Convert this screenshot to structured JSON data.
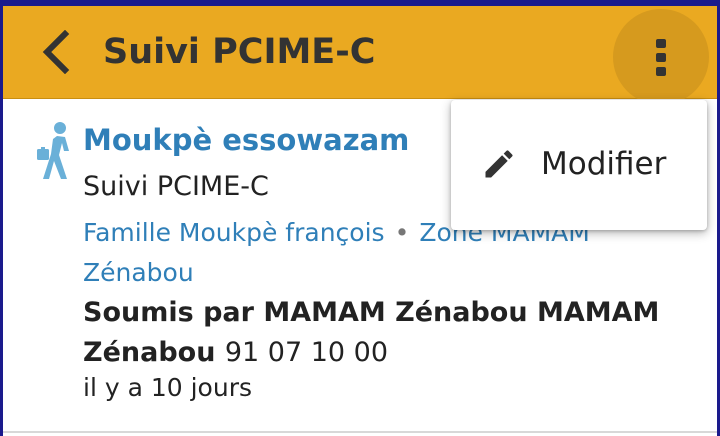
{
  "header": {
    "title": "Suivi PCIME-C"
  },
  "report": {
    "patient_name": "Moukpè essowazam",
    "form_name": "Suivi PCIME-C",
    "lineage": [
      "Famille Moukpè françois",
      "Zone MAMAM Zénabou"
    ],
    "lineage_separator": "•",
    "submitted_by": "Soumis par MAMAM Zénabou MAMAM Zénabou",
    "phone": "91 07 10 00",
    "relative_time": "il y a 10 jours"
  },
  "menu": {
    "edit_label": "Modifier"
  },
  "colors": {
    "appbar": "#eaa921",
    "link": "#2f7fb8"
  }
}
